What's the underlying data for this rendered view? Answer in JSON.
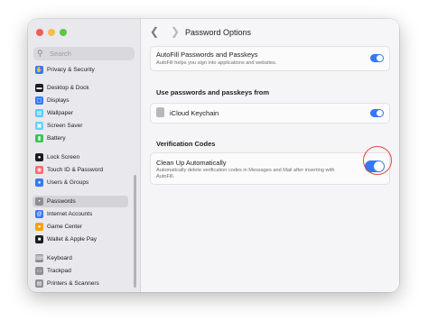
{
  "search": {
    "placeholder": "Search"
  },
  "sidebar": {
    "items": [
      {
        "label": "Privacy & Security",
        "icon": "hand-icon",
        "color": "#3478f6",
        "selected": false
      },
      {
        "label": "Desktop & Dock",
        "icon": "dock-icon",
        "color": "#1c1c1e",
        "selected": false
      },
      {
        "label": "Displays",
        "icon": "display-icon",
        "color": "#3478f6",
        "selected": false
      },
      {
        "label": "Wallpaper",
        "icon": "wallpaper-icon",
        "color": "#5ac8fa",
        "selected": false
      },
      {
        "label": "Screen Saver",
        "icon": "screen-saver-icon",
        "color": "#64d2ff",
        "selected": false
      },
      {
        "label": "Battery",
        "icon": "battery-icon",
        "color": "#34c759",
        "selected": false
      },
      {
        "label": "Lock Screen",
        "icon": "lock-icon",
        "color": "#1c1c1e",
        "selected": false
      },
      {
        "label": "Touch ID & Password",
        "icon": "fingerprint-icon",
        "color": "#ff6b6b",
        "selected": false
      },
      {
        "label": "Users & Groups",
        "icon": "users-icon",
        "color": "#3478f6",
        "selected": false
      },
      {
        "label": "Passwords",
        "icon": "key-icon",
        "color": "#8e8e93",
        "selected": true
      },
      {
        "label": "Internet Accounts",
        "icon": "at-icon",
        "color": "#3478f6",
        "selected": false
      },
      {
        "label": "Game Center",
        "icon": "game-center-icon",
        "color": "#ff9f0a",
        "selected": false
      },
      {
        "label": "Wallet & Apple Pay",
        "icon": "wallet-icon",
        "color": "#1c1c1e",
        "selected": false
      },
      {
        "label": "Keyboard",
        "icon": "keyboard-icon",
        "color": "#8e8e93",
        "selected": false
      },
      {
        "label": "Trackpad",
        "icon": "trackpad-icon",
        "color": "#8e8e93",
        "selected": false
      },
      {
        "label": "Printers & Scanners",
        "icon": "printer-icon",
        "color": "#8e8e93",
        "selected": false
      }
    ]
  },
  "toolbar": {
    "title": "Password Options",
    "back_icon": "chevron-left-icon",
    "forward_icon": "chevron-right-icon"
  },
  "main": {
    "autofill": {
      "title": "AutoFill Passwords and Passkeys",
      "description": "AutoFill helps you sign into applications and websites.",
      "enabled": true
    },
    "use_from": {
      "header": "Use passwords and passkeys from",
      "source_label": "iCloud Keychain",
      "enabled": true
    },
    "verification": {
      "header": "Verification Codes",
      "title": "Clean Up Automatically",
      "description": "Automatically delete verification codes in Messages and Mail after inserting with AutoFill.",
      "enabled": true
    }
  },
  "colors": {
    "accent": "#3478f6",
    "highlight": "#e0473f"
  }
}
